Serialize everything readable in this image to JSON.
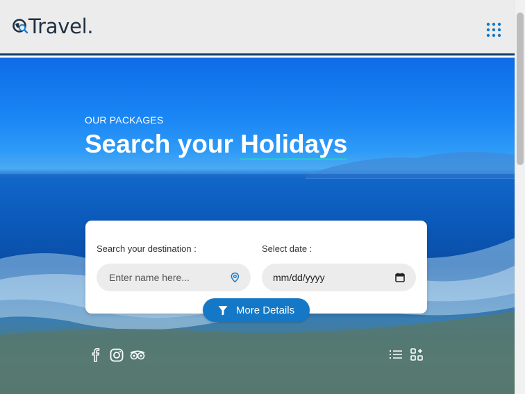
{
  "header": {
    "brand": "Travel.",
    "logo_icon": "globe-search-icon",
    "menu_icon": "grid-menu-icon"
  },
  "hero": {
    "eyebrow": "OUR PACKAGES",
    "title_prefix": "Search your ",
    "title_accent": "Holidays"
  },
  "search": {
    "destination_label": "Search your destination :",
    "destination_placeholder": "Enter name here...",
    "destination_icon": "location-pin-icon",
    "date_label": "Select date :",
    "date_value": "mm/dd/yyyy",
    "date_icon": "calendar-icon",
    "more_button_label": "More Details",
    "more_button_icon": "filter-icon"
  },
  "social": [
    "facebook-icon",
    "instagram-icon",
    "tripadvisor-icon"
  ],
  "view_toggles": [
    "list-view-icon",
    "grid-add-view-icon"
  ],
  "colors": {
    "accent": "#1478c7",
    "underline": "#2ec1d6",
    "header_bg": "#ececec",
    "header_border": "#0e3b66"
  }
}
